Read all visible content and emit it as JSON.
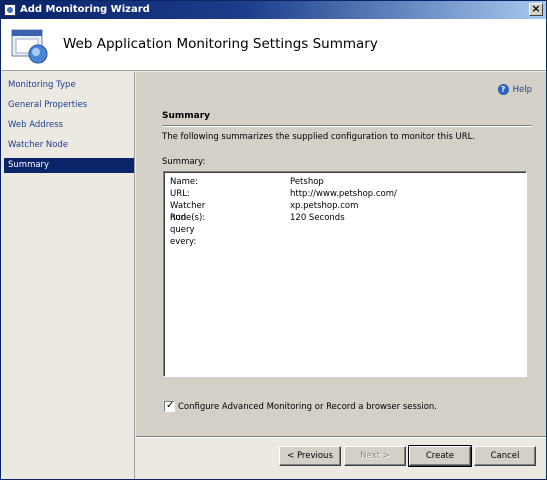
{
  "window": {
    "title": "Add Monitoring Wizard",
    "close_glyph": "×"
  },
  "header": {
    "heading": "Web Application Monitoring Settings Summary"
  },
  "nav": {
    "items": [
      {
        "label": "Monitoring Type"
      },
      {
        "label": "General Properties"
      },
      {
        "label": "Web Address"
      },
      {
        "label": "Watcher Node"
      },
      {
        "label": "Summary"
      }
    ],
    "active_index": 4
  },
  "main": {
    "help_label": "Help",
    "section_title": "Summary",
    "description": "The following summarizes the supplied configuration to monitor this URL.",
    "summary_label": "Summary:",
    "summary_rows": [
      {
        "key": "Name:",
        "value": "Petshop"
      },
      {
        "key": "URL:",
        "value": "http://www.petshop.com/"
      },
      {
        "key": "Watcher node(s):",
        "value": "xp.petshop.com"
      },
      {
        "key": "Run query every:",
        "value": "120 Seconds"
      }
    ],
    "checkbox": {
      "label": "Configure Advanced Monitoring or Record a browser session.",
      "checked": true
    }
  },
  "buttons": {
    "previous": "< Previous",
    "next": "Next >",
    "create": "Create",
    "cancel": "Cancel"
  },
  "colors": {
    "title_bar": "#0a246a",
    "nav_active": "#0a246a",
    "link": "#1a3e8f"
  }
}
